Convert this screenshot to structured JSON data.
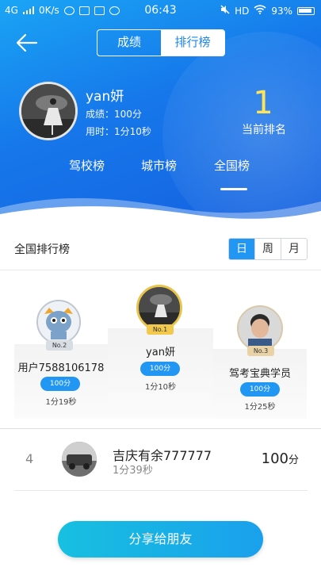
{
  "status_bar": {
    "network": "4G",
    "speed": "0K/s",
    "time": "06:43",
    "hd": "HD",
    "battery": "93%"
  },
  "toggle": {
    "tab1": "成绩",
    "tab2": "排行榜",
    "active": "排行榜"
  },
  "user": {
    "name": "yan妍",
    "score": "成绩：100分",
    "time_used": "用时：1分10秒",
    "rank": "1",
    "rank_label": "当前排名"
  },
  "board_tabs": [
    {
      "label": "驾校榜"
    },
    {
      "label": "城市榜"
    },
    {
      "label": "全国榜",
      "active": true
    }
  ],
  "section": {
    "title": "全国排行榜",
    "periods": [
      "日",
      "周",
      "月"
    ],
    "active_period": "日"
  },
  "podium": {
    "first": {
      "medal": "No.1",
      "name": "yan妍",
      "score": "100分",
      "time": "1分10秒"
    },
    "second": {
      "medal": "No.2",
      "name": "用户7588106178",
      "score": "100分",
      "time": "1分19秒"
    },
    "third": {
      "medal": "No.3",
      "name": "驾考宝典学员",
      "score": "100分",
      "time": "1分25秒"
    }
  },
  "list": [
    {
      "rank": "4",
      "name": "吉庆有余777777",
      "time": "1分39秒",
      "score": "100",
      "unit": "分"
    }
  ],
  "share_button": "分享给朋友",
  "colors": {
    "primary": "#1a86ee",
    "accent_blue": "#2196f3",
    "rank_yellow": "#ffe45a"
  }
}
